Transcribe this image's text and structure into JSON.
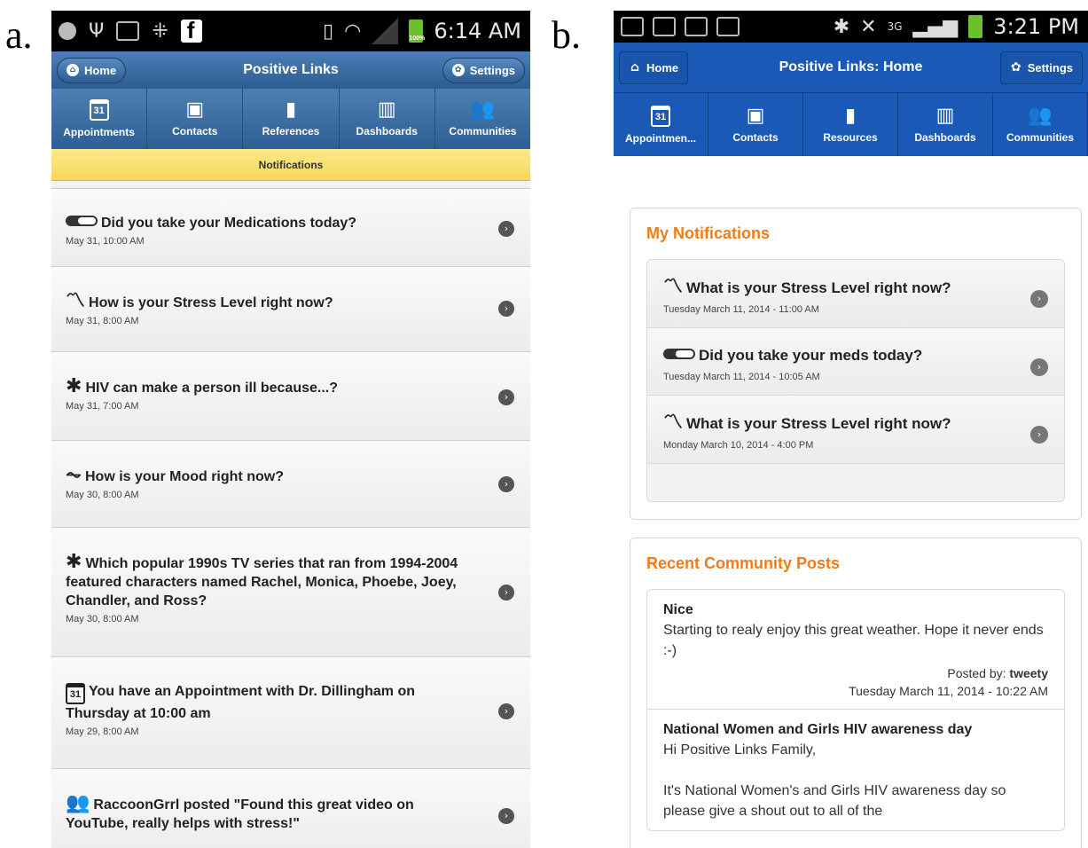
{
  "labels": {
    "a": "a.",
    "b": "b."
  },
  "phone_a": {
    "status": {
      "time": "6:14 AM",
      "battery": "100%"
    },
    "header": {
      "home": "Home",
      "title": "Positive Links",
      "settings": "Settings"
    },
    "nav": [
      {
        "label": "Appointments",
        "icon": "calendar-icon",
        "glyph": "31"
      },
      {
        "label": "Contacts",
        "icon": "contact-card-icon",
        "glyph": "▣"
      },
      {
        "label": "References",
        "icon": "book-icon",
        "glyph": "▮"
      },
      {
        "label": "Dashboards",
        "icon": "bar-chart-icon",
        "glyph": "▥"
      },
      {
        "label": "Communities",
        "icon": "people-icon",
        "glyph": "👥"
      }
    ],
    "section": "Notifications",
    "items": [
      {
        "icon": "toggle-icon",
        "title": "Did you take your Medications today?",
        "date": "May 31, 10:00 AM"
      },
      {
        "icon": "stress-graph-icon",
        "glyph": "〽",
        "title": "How is your Stress Level right now?",
        "date": "May 31, 8:00 AM"
      },
      {
        "icon": "puzzle-icon",
        "glyph": "✱",
        "title": "HIV can make a person ill because...?",
        "date": "May 31, 7:00 AM"
      },
      {
        "icon": "heartbeat-icon",
        "glyph": "⏦",
        "title": "How is your Mood right now?",
        "date": "May 30, 8:00 AM"
      },
      {
        "icon": "puzzle-icon",
        "glyph": "✱",
        "title": "Which popular 1990s TV series that ran from 1994-2004 featured characters named Rachel, Monica, Phoebe, Joey, Chandler, and Ross?",
        "date": "May 30, 8:00 AM"
      },
      {
        "icon": "calendar-icon",
        "glyph": "31",
        "title": "You have an Appointment with Dr. Dillingham on Thursday at 10:00 am",
        "date": "May 29, 8:00 AM"
      },
      {
        "icon": "people-icon",
        "glyph": "👥",
        "title": "RaccoonGrrl posted \"Found this great video on YouTube, really helps with stress!\"",
        "date": ""
      }
    ]
  },
  "phone_b": {
    "status": {
      "time": "3:21 PM"
    },
    "header": {
      "home": "Home",
      "title": "Positive Links: Home",
      "settings": "Settings"
    },
    "nav": [
      {
        "label": "Appointmen...",
        "icon": "calendar-icon",
        "glyph": "31"
      },
      {
        "label": "Contacts",
        "icon": "contact-card-icon",
        "glyph": "▣"
      },
      {
        "label": "Resources",
        "icon": "book-icon",
        "glyph": "▮"
      },
      {
        "label": "Dashboards",
        "icon": "bar-chart-icon",
        "glyph": "▥"
      },
      {
        "label": "Communities",
        "icon": "people-icon",
        "glyph": "👥"
      }
    ],
    "notifications": {
      "title": "My Notifications",
      "items": [
        {
          "icon": "stress-graph-icon",
          "glyph": "〽",
          "title": "What is your Stress Level right now?",
          "date": "Tuesday March 11, 2014 - 11:00 AM"
        },
        {
          "icon": "toggle-icon",
          "title": "Did you take your meds today?",
          "date": "Tuesday March 11, 2014 - 10:05 AM"
        },
        {
          "icon": "stress-graph-icon",
          "glyph": "〽",
          "title": "What is your Stress Level right now?",
          "date": "Monday March 10, 2014 - 4:00 PM"
        }
      ]
    },
    "community": {
      "title": "Recent Community Posts",
      "posts": [
        {
          "title": "Nice",
          "body": "Starting to realy enjoy this great weather. Hope it never ends :-)",
          "posted_by_label": "Posted by:",
          "author": "tweety",
          "date": "Tuesday March 11, 2014 - 10:22 AM"
        },
        {
          "title": "National Women and Girls HIV awareness day",
          "body": "Hi Positive Links Family,",
          "body2": "It's National Women's and Girls HIV awareness day so please give a shout out to all of the"
        }
      ]
    }
  }
}
